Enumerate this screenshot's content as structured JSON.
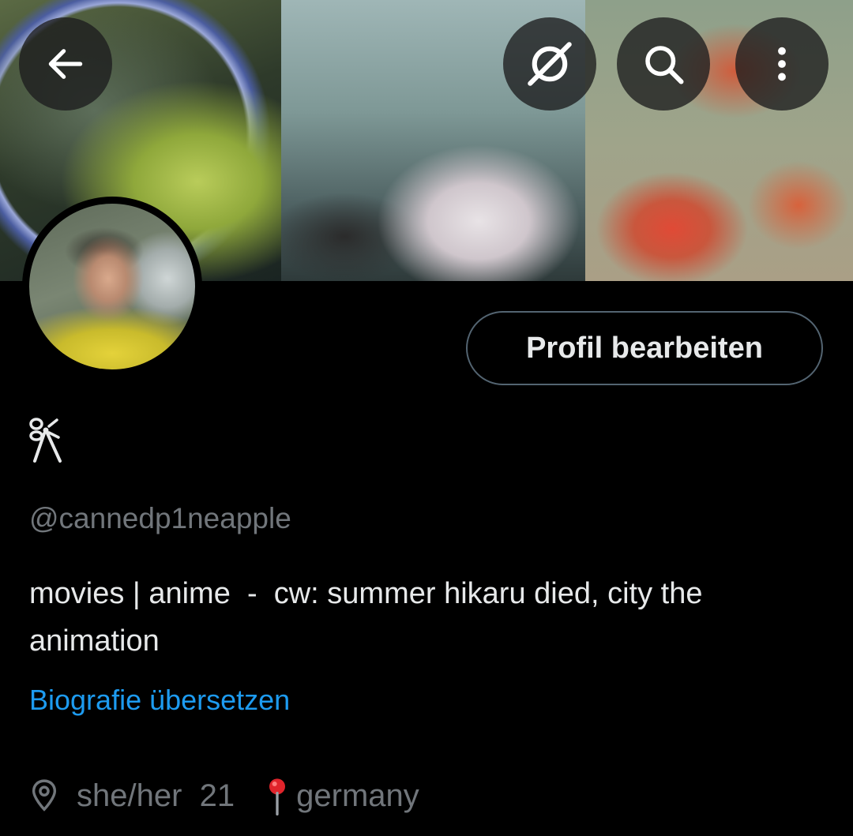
{
  "header": {
    "back_icon": "arrow-left-icon",
    "grok_icon": "grok-icon",
    "search_icon": "search-icon",
    "more_icon": "more-vertical-icon"
  },
  "profile": {
    "display_name_icon": "ribbon-bow-glyph",
    "edit_button_label": "Profil bearbeiten",
    "handle": "@cannedp1neapple",
    "bio": "movies | anime  -  cw: summer hikaru died, city the animation",
    "translate_link": "Biografie übersetzen",
    "location_icon": "location-pin-icon",
    "location_text": "she/her  21",
    "location_pin_emoji": "📍",
    "location_place": "germany"
  },
  "colors": {
    "background": "#000000",
    "text_primary": "#e7e9ea",
    "text_secondary": "#71767b",
    "link": "#1d9bf0",
    "button_border": "#536471"
  }
}
